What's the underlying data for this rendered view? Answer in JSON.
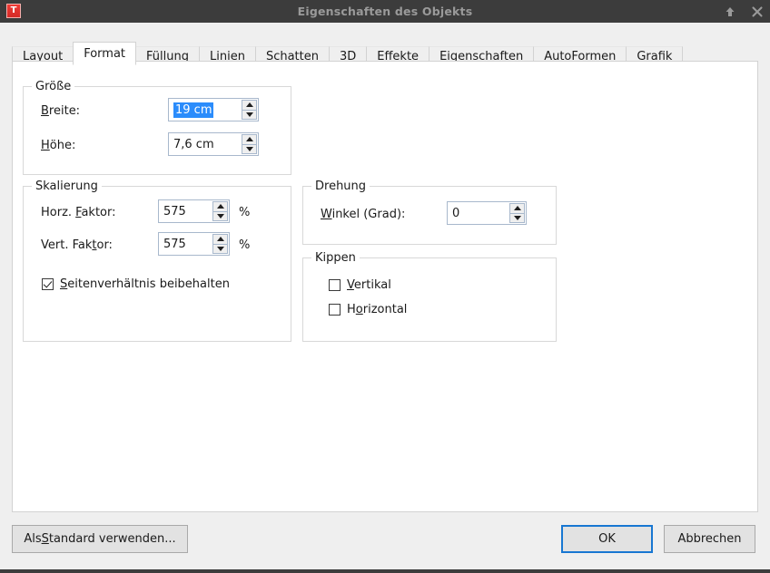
{
  "window": {
    "title": "Eigenschaften des Objekts",
    "app_icon_letter": "T",
    "icon_color": "#e3342f",
    "titlebar_color": "#3c3c3c",
    "title_color": "#9a9a9a",
    "controls": [
      {
        "name": "shade-up-icon",
        "glyph": "↑",
        "label": "Aufrollen"
      },
      {
        "name": "close-icon",
        "glyph": "✕",
        "label": "Schließen"
      }
    ]
  },
  "tabs": [
    {
      "label": "Layout",
      "active": false
    },
    {
      "label": "Format",
      "active": true
    },
    {
      "label": "Füllung",
      "active": false
    },
    {
      "label": "Linien",
      "active": false
    },
    {
      "label": "Schatten",
      "active": false
    },
    {
      "label": "3D",
      "active": false
    },
    {
      "label": "Effekte",
      "active": false
    },
    {
      "label": "Eigenschaften",
      "active": false
    },
    {
      "label": "AutoFormen",
      "active": false
    },
    {
      "label": "Grafik",
      "active": false
    }
  ],
  "groups": {
    "groesse": {
      "title": "Größe",
      "breite": {
        "label_prefix": "",
        "label_acc": "B",
        "label_suffix": "reite:",
        "value": "19 cm",
        "selected": true
      },
      "hoehe": {
        "label_prefix": "",
        "label_acc": "H",
        "label_suffix": "öhe:",
        "value": "7,6 cm",
        "selected": false
      }
    },
    "skalierung": {
      "title": "Skalierung",
      "horz": {
        "label_prefix": "Horz. ",
        "label_acc": "F",
        "label_suffix": "aktor:",
        "value": "575",
        "unit": "%"
      },
      "vert": {
        "label_prefix": "Vert. Fak",
        "label_acc": "t",
        "label_suffix": "or:",
        "value": "575",
        "unit": "%"
      },
      "keep_ratio": {
        "label_prefix": "",
        "label_acc": "S",
        "label_suffix": "eitenverhältnis beibehalten",
        "checked": true
      }
    },
    "drehung": {
      "title": "Drehung",
      "winkel": {
        "label_prefix": "",
        "label_acc": "W",
        "label_suffix": "inkel (Grad):",
        "value": "0"
      }
    },
    "kippen": {
      "title": "Kippen",
      "vertikal": {
        "label_prefix": "",
        "label_acc": "V",
        "label_suffix": "ertikal",
        "checked": false
      },
      "horizontal": {
        "label_prefix": "H",
        "label_acc": "o",
        "label_suffix": "rizontal",
        "checked": false
      }
    }
  },
  "buttons": {
    "use_as_default_prefix": "Als ",
    "use_as_default_acc": "S",
    "use_as_default_suffix": "tandard verwenden...",
    "ok": "OK",
    "cancel": "Abbrechen",
    "focus_color": "#1877d2"
  }
}
